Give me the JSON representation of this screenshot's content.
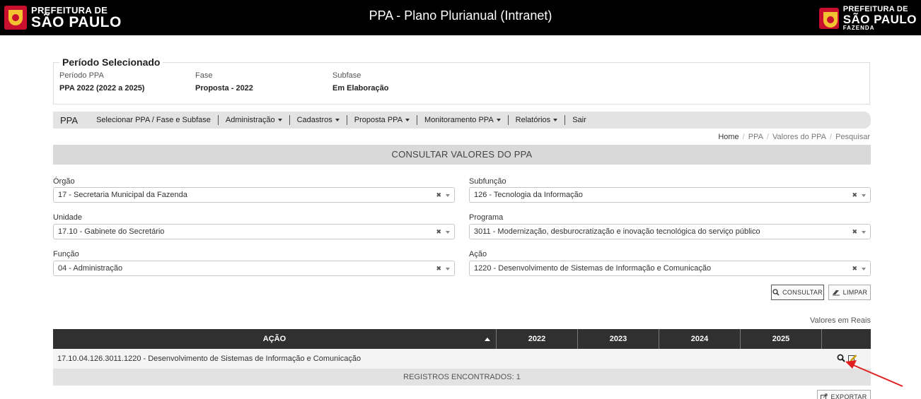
{
  "header": {
    "logo_left": {
      "line1": "PREFEITURA DE",
      "line2": "SÃO PAULO"
    },
    "title": "PPA - Plano Plurianual (Intranet)",
    "logo_right": {
      "line1": "PREFEITURA DE",
      "line2": "SÃO PAULO",
      "line3": "FAZENDA"
    }
  },
  "periodo": {
    "legend": "Período Selecionado",
    "periodo_label": "Período PPA",
    "periodo_value": "PPA 2022 (2022 a 2025)",
    "fase_label": "Fase",
    "fase_value": "Proposta - 2022",
    "subfase_label": "Subfase",
    "subfase_value": "Em Elaboração"
  },
  "nav": {
    "brand": "PPA",
    "items": [
      "Selecionar PPA / Fase e Subfase",
      "Administração",
      "Cadastros",
      "Proposta PPA",
      "Monitoramento PPA",
      "Relatórios",
      "Sair"
    ]
  },
  "breadcrumb": [
    "Home",
    "PPA",
    "Valores do PPA",
    "Pesquisar"
  ],
  "page_title": "CONSULTAR VALORES DO PPA",
  "filters": {
    "orgao": {
      "label": "Órgão",
      "value": "17 - Secretaria Municipal da Fazenda"
    },
    "subfuncao": {
      "label": "Subfunção",
      "value": "126 - Tecnologia da Informação"
    },
    "unidade": {
      "label": "Unidade",
      "value": "17.10 - Gabinete do Secretário"
    },
    "programa": {
      "label": "Programa",
      "value": "3011 - Modernização, desburocratização e inovação tecnológica do serviço público"
    },
    "funcao": {
      "label": "Função",
      "value": "04 - Administração"
    },
    "acao": {
      "label": "Ação",
      "value": "1220 - Desenvolvimento de Sistemas de Informação e Comunicação"
    },
    "clear_glyph": "✖"
  },
  "buttons": {
    "consultar": "CONSULTAR",
    "limpar": "LIMPAR",
    "exportar": "EXPORTAR"
  },
  "valores_reais": "Valores em Reais",
  "table": {
    "headers": [
      "AÇÃO",
      "2022",
      "2023",
      "2024",
      "2025"
    ],
    "rows": [
      {
        "acao": "17.10.04.126.3011.1220 - Desenvolvimento de Sistemas de Informação e Comunicação"
      }
    ],
    "footer": "REGISTROS ENCONTRADOS: 1"
  },
  "colors": {
    "header_bg": "#000000",
    "table_head_bg": "#303030",
    "annotation_arrow": "#e02020"
  },
  "icons": [
    "search-icon",
    "edit-icon",
    "export-icon",
    "eraser-icon",
    "sort-asc-icon"
  ]
}
